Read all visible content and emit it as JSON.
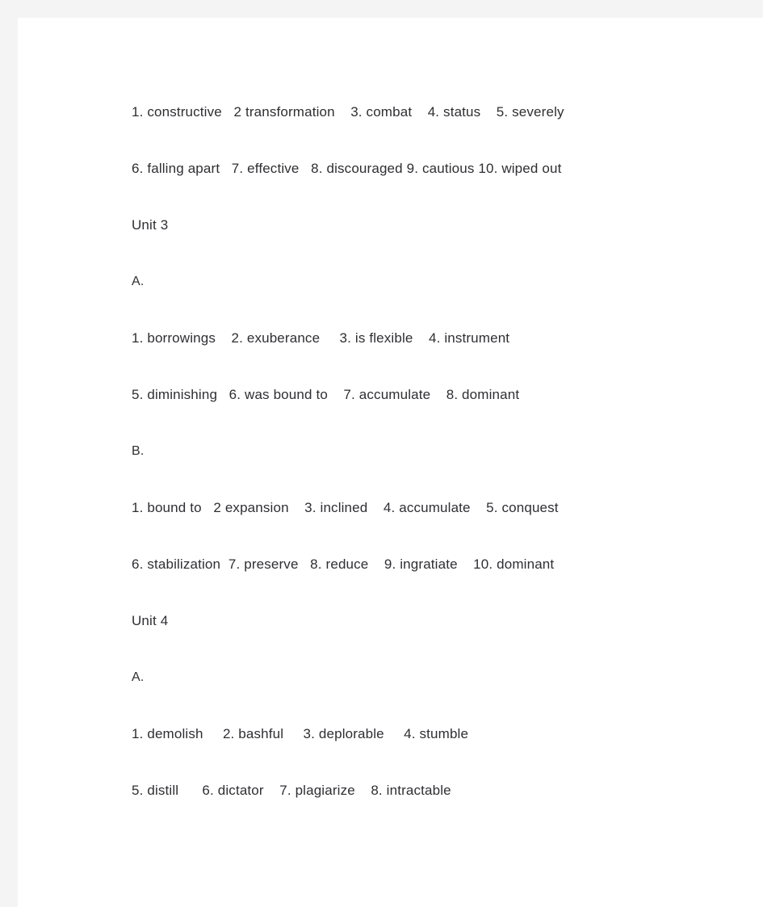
{
  "document": {
    "background_color": "#f4f4f4",
    "page_color": "#ffffff",
    "text_color": "#2f2f33"
  },
  "content": {
    "blocks": [
      {
        "kind": "answer-line",
        "name": "answers-unit2-b-line1",
        "text": "1. constructive   2 transformation    3. combat    4. status    5. severely"
      },
      {
        "kind": "answer-line",
        "name": "answers-unit2-b-line2",
        "text": "6. falling apart   7. effective   8. discouraged 9. cautious 10. wiped out"
      },
      {
        "kind": "section-heading",
        "name": "unit-3-heading",
        "text": "Unit 3"
      },
      {
        "kind": "part-label",
        "name": "unit-3-part-a-label",
        "text": "A."
      },
      {
        "kind": "answer-line",
        "name": "answers-unit3-a-line1",
        "text": "1. borrowings    2. exuberance     3. is flexible    4. instrument"
      },
      {
        "kind": "answer-line",
        "name": "answers-unit3-a-line2",
        "text": "5. diminishing   6. was bound to    7. accumulate    8. dominant"
      },
      {
        "kind": "part-label",
        "name": "unit-3-part-b-label",
        "text": "B."
      },
      {
        "kind": "answer-line",
        "name": "answers-unit3-b-line1",
        "text": "1. bound to   2 expansion    3. inclined    4. accumulate    5. conquest"
      },
      {
        "kind": "answer-line",
        "name": "answers-unit3-b-line2",
        "text": "6. stabilization  7. preserve   8. reduce    9. ingratiate    10. dominant"
      },
      {
        "kind": "section-heading",
        "name": "unit-4-heading",
        "text": "Unit 4"
      },
      {
        "kind": "part-label",
        "name": "unit-4-part-a-label",
        "text": "A."
      },
      {
        "kind": "answer-line",
        "name": "answers-unit4-a-line1",
        "text": "1. demolish     2. bashful     3. deplorable     4. stumble"
      },
      {
        "kind": "answer-line",
        "name": "answers-unit4-a-line2",
        "text": "5. distill      6. dictator    7. plagiarize    8. intractable"
      }
    ]
  }
}
